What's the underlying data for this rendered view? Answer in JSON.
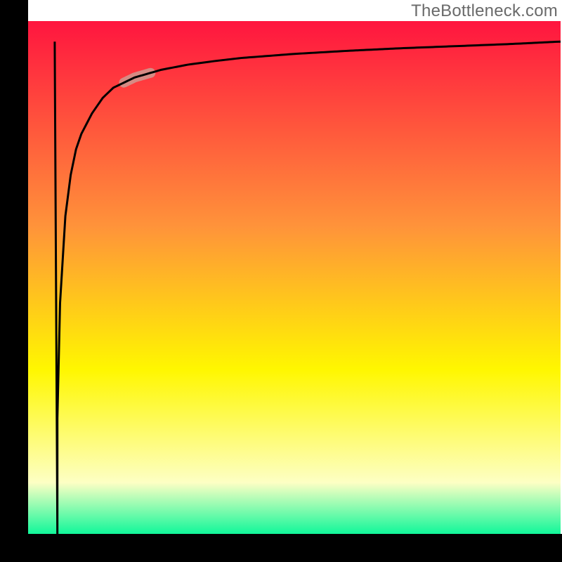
{
  "watermark": "TheBottleneck.com",
  "chart_data": {
    "type": "line",
    "title": "",
    "xlabel": "",
    "ylabel": "",
    "xlim": [
      0,
      100
    ],
    "ylim": [
      0,
      100
    ],
    "grid": false,
    "legend": false,
    "background_gradient": {
      "top": "#ff153f",
      "mid1": "#ff933a",
      "mid2": "#fff700",
      "mid3": "#fdffc4",
      "bottom": "#11f79a"
    },
    "series": [
      {
        "name": "curve",
        "color": "#000000",
        "note": "Sharp spike near x≈5 down to y≈0 then power-law rise approaching ~96 at right edge",
        "x": [
          5,
          6,
          7,
          8,
          9,
          10,
          12,
          14,
          16,
          18,
          20,
          25,
          30,
          35,
          40,
          50,
          60,
          70,
          80,
          90,
          100
        ],
        "y": [
          0,
          45,
          62,
          70,
          75,
          78,
          82,
          85,
          87,
          88,
          89,
          90.5,
          91.5,
          92.2,
          92.8,
          93.6,
          94.2,
          94.7,
          95.1,
          95.5,
          96
        ]
      }
    ],
    "highlight_segment": {
      "note": "pale pink thick segment on curve around x≈18–23",
      "color": "#d68b84",
      "x_start": 18,
      "x_end": 23
    }
  }
}
